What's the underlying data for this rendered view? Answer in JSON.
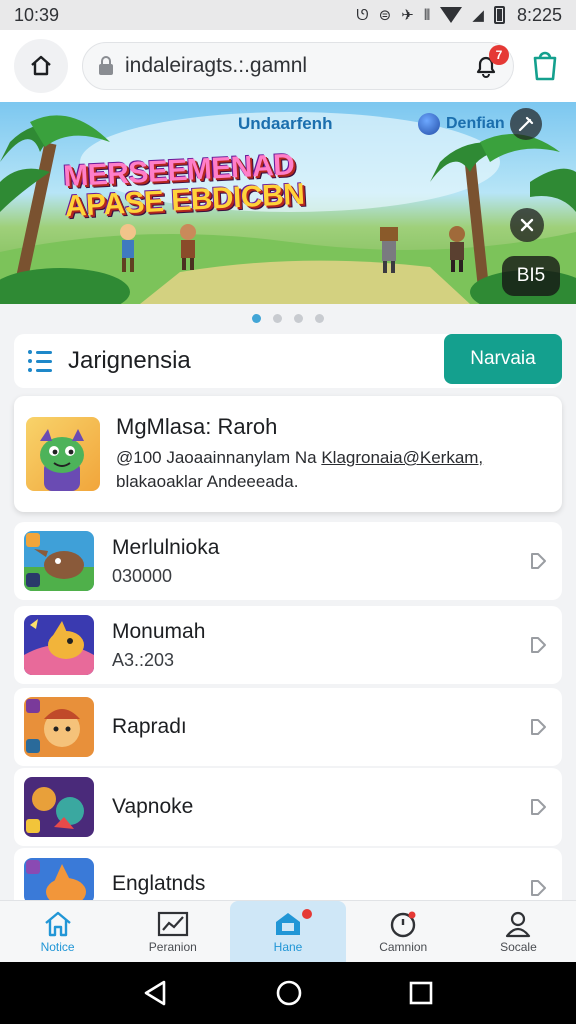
{
  "status_bar": {
    "time": "10:39",
    "right_time": "8:225"
  },
  "top_bar": {
    "url": "indaleiragts.:.gamnl",
    "notification_count": "7"
  },
  "banner": {
    "header_text": "Undaarfenh",
    "pill_text": "Denfian",
    "title_line1": "MERSEEMENAD",
    "title_line2": "APASE EBDICBN",
    "badge": "BI5",
    "dots": 4,
    "active_dot": 0
  },
  "section": {
    "title": "Jarignensia",
    "button_label": "Narvaia"
  },
  "featured": {
    "title": "MgMlasa: Raroh",
    "desc_line1_prefix": "@100 Jaoaainnanylam Na ",
    "desc_line1_link": "Klagronaia@Kerkam,",
    "desc_line2": "blakaoaklar Andeeeada."
  },
  "list": [
    {
      "name": "Merlulnioka",
      "sub": "030000"
    },
    {
      "name": "Monumah",
      "sub": "A3.:203"
    },
    {
      "name": "Rapradı",
      "sub": ""
    },
    {
      "name": "Vapnoke",
      "sub": ""
    },
    {
      "name": "Englatnds",
      "sub": ""
    }
  ],
  "bottom_nav": [
    {
      "label": "Notice"
    },
    {
      "label": "Peranion"
    },
    {
      "label": "Hane"
    },
    {
      "label": "Camnion"
    },
    {
      "label": "Socale"
    }
  ],
  "colors": {
    "accent": "#14a08e",
    "link_blue": "#2196d6",
    "badge_red": "#e53935"
  }
}
